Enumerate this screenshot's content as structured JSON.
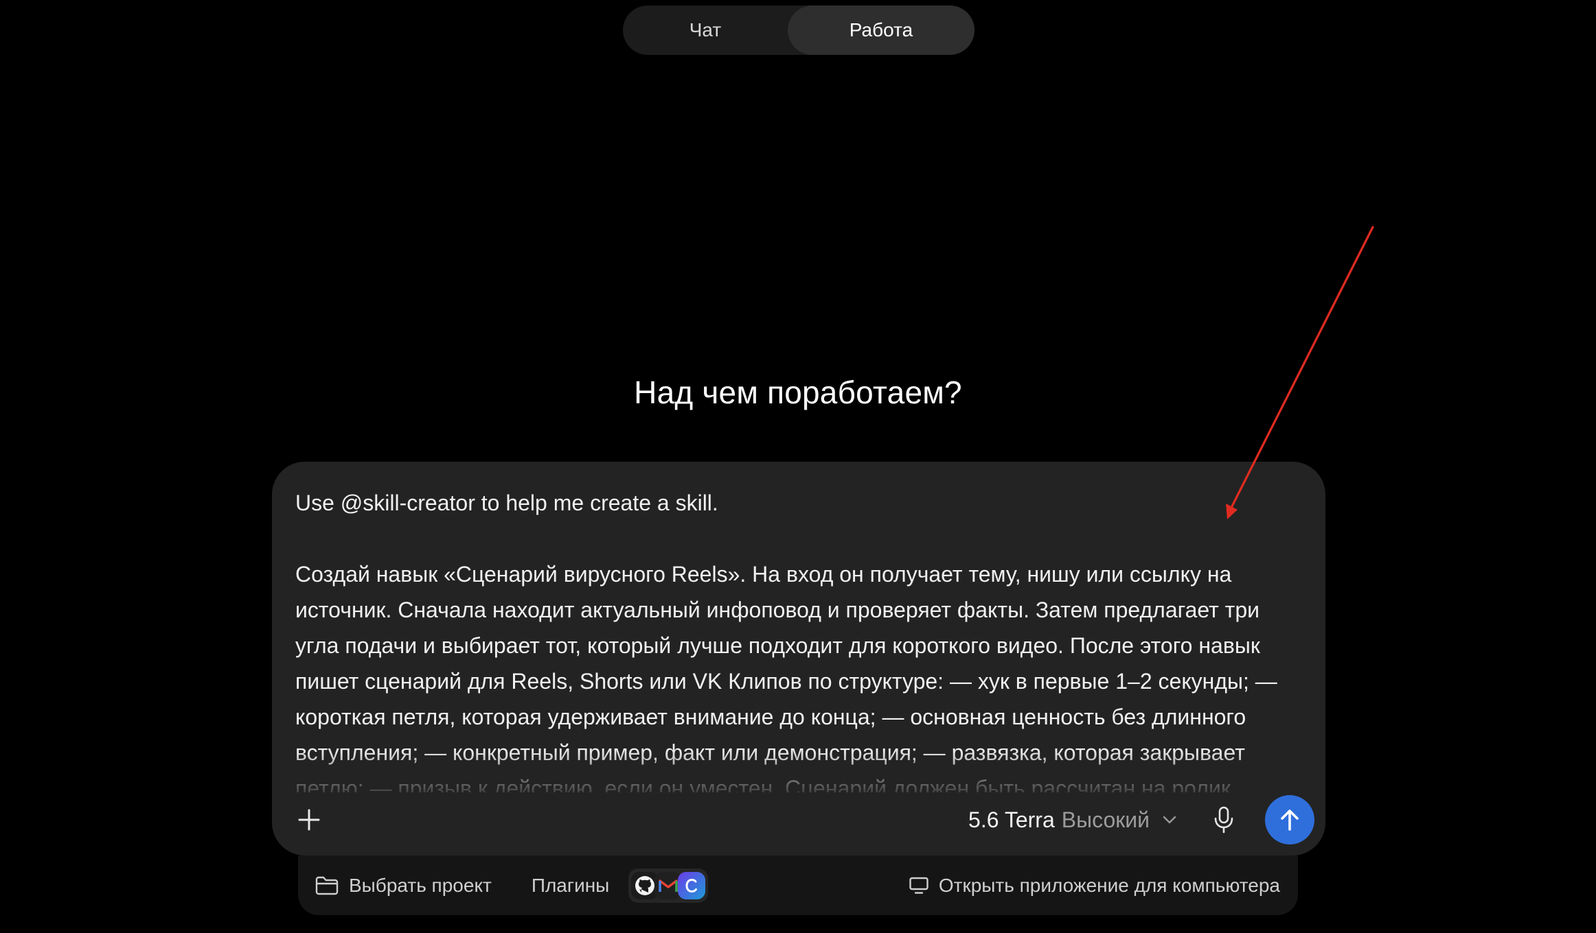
{
  "mode_toggle": {
    "chat_label": "Чат",
    "work_label": "Работа",
    "active": "Работа"
  },
  "headline": "Над чем поработаем?",
  "composer": {
    "line1": "Use @skill-creator to help me create a skill.",
    "paragraph": "Создай навык «Сценарий вирусного Reels». На вход он получает тему, нишу или ссылку на источник. Сначала находит актуальный инфоповод и проверяет факты. Затем предлагает три угла подачи и выбирает тот, который лучше подходит для короткого видео. После этого навык пишет сценарий для Reels, Shorts или VK Клипов по структуре: — хук в первые 1–2 секунды; — короткая петля, которая удерживает внимание до конца; — основная ценность без длинного вступления; — конкретный пример, факт или демонстрация; — развязка, которая закрывает петлю; — призыв к действию, если он уместен. Сценарий должен быть рассчитан на ролик",
    "model_name": "5.6 Terra",
    "model_effort": "Высокий",
    "icons": {
      "add": "plus-icon",
      "model_menu": "chevron-down-icon",
      "mic": "microphone-icon",
      "send": "arrow-up-icon"
    },
    "send_color": "#2f6fdc"
  },
  "bottom_bar": {
    "project_label": "Выбрать проект",
    "plugins_label": "Плагины",
    "plugin_icons": [
      "github-icon",
      "gmail-icon",
      "canva-icon"
    ],
    "desktop_label": "Открыть приложение для компьютера",
    "icons": {
      "project": "folder-icon",
      "desktop": "monitor-icon"
    }
  },
  "annotation": {
    "color": "#e02b20",
    "shape": "arrow"
  }
}
